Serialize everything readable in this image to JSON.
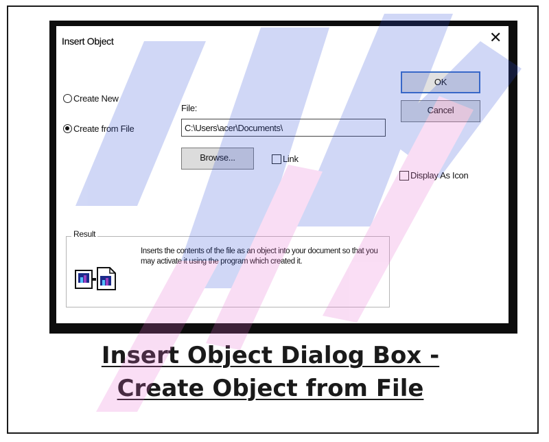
{
  "dialog": {
    "title": "Insert Object",
    "close_glyph": "✕",
    "options": {
      "create_new_label": "Create New",
      "create_from_file_label": "Create from File",
      "selected": "create_from_file"
    },
    "file": {
      "label": "File:",
      "value": "C:\\Users\\acer\\Documents\\"
    },
    "buttons": {
      "ok_label": "OK",
      "cancel_label": "Cancel",
      "browse_label": "Browse..."
    },
    "link": {
      "label": "Link",
      "checked": false
    },
    "display_as_icon": {
      "label": "Display As Icon",
      "checked": false
    },
    "result": {
      "legend": "Result",
      "text": "Inserts the contents of the file as an object into your document so that you may activate it using the program which created it.",
      "icon": "embedded-object-icon"
    }
  },
  "caption": {
    "line1": "Insert Object Dialog Box -",
    "line2": "Create Object from File"
  },
  "colors": {
    "frame": "#1a1a1a",
    "dialog_shadow": "#0d0d0d",
    "ok_border": "#3a6fc4",
    "button_face": "#e1e1e1",
    "watermark_blue": "#2d4fd8",
    "watermark_pink": "#e86ad0"
  }
}
